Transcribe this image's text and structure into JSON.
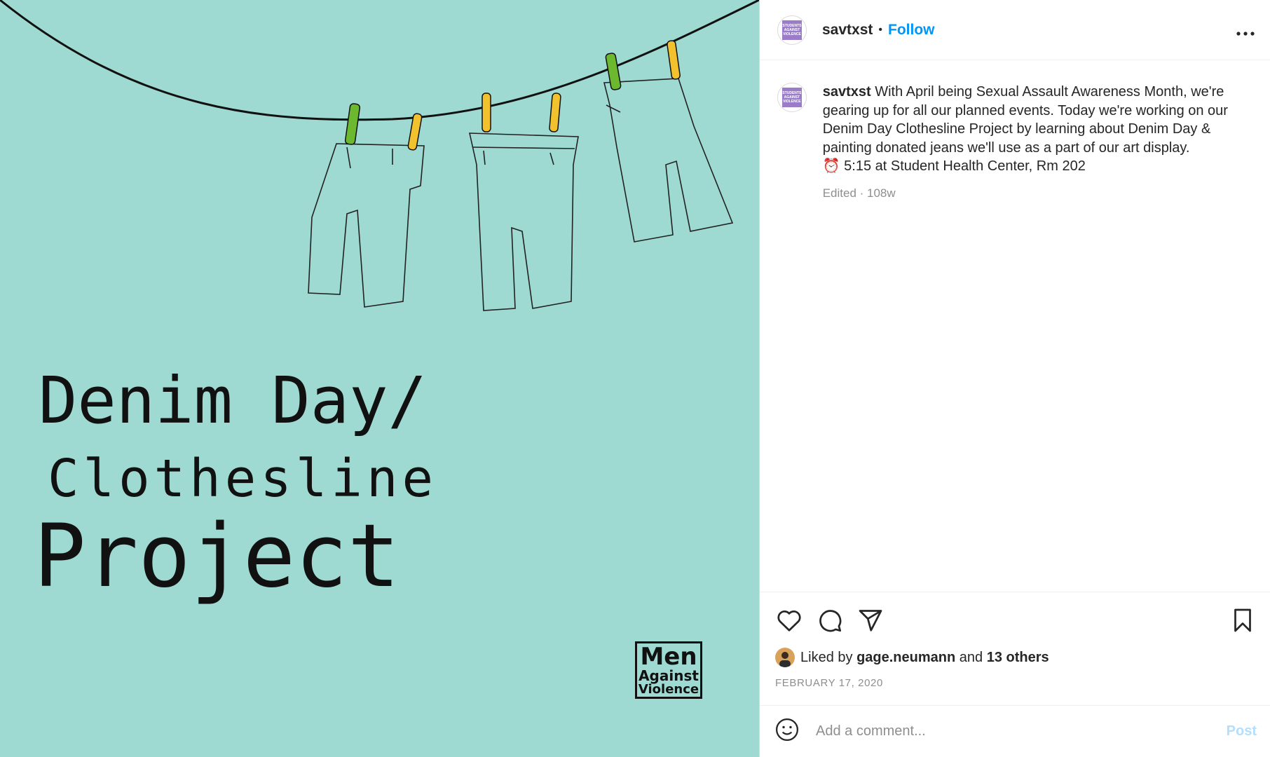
{
  "media": {
    "title_line1": "Denim Day/",
    "title_line2": "Clothesline",
    "title_line3": "Project",
    "logo_line1": "Men",
    "logo_line2": "Against",
    "logo_line3": "Violence",
    "background_color": "#9ed9d2"
  },
  "header": {
    "avatar_text": "STUDENTS AGAINST VIOLENCE",
    "username": "savtxst",
    "separator": "•",
    "follow_label": "Follow",
    "more_icon": "more-horizontal-icon"
  },
  "caption": {
    "username": "savtxst",
    "text": "With April being Sexual Assault Awareness Month, we're gearing up for all our planned events. Today we're working on our Denim Day Clothesline Project by learning about Denim Day & painting donated jeans we'll use as a part of our art display.",
    "time_line": "⏰ 5:15 at Student Health Center, Rm 202",
    "edited": "Edited",
    "age": "108w"
  },
  "actions": {
    "like_icon": "heart-icon",
    "comment_icon": "comment-icon",
    "share_icon": "send-icon",
    "save_icon": "bookmark-icon"
  },
  "likes": {
    "prefix": "Liked by",
    "user": "gage.neumann",
    "and": "and",
    "others": "13 others"
  },
  "date": "FEBRUARY 17, 2020",
  "comment_box": {
    "emoji_icon": "emoji-icon",
    "placeholder": "Add a comment...",
    "post_label": "Post"
  },
  "colors": {
    "accent": "#0095f6",
    "post_disabled": "#b2dffc",
    "muted": "#8e8e8e"
  }
}
